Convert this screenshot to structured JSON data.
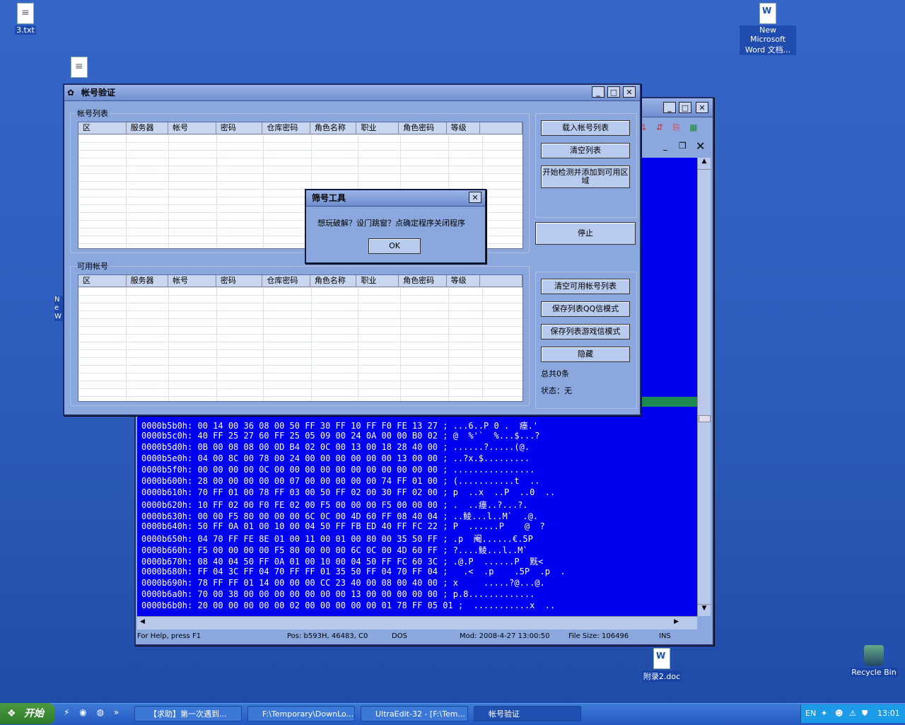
{
  "desktop": {
    "icons": [
      {
        "label": "3.txt"
      },
      {
        "label": "New Microsoft Word 文档..."
      },
      {
        "label": "附录2.doc"
      },
      {
        "label": "Recycle Bin"
      }
    ],
    "partial_label": "Ne W"
  },
  "editor": {
    "hex_lines": [
      "0000b5b0h: 00 14 00 36 08 00 50 FF 30 FF 10 FF F0 FE 13 27 ; ...6..P 0 .  瘗.'",
      "0000b5c0h: 40 FF 25 27 60 FF 25 05 09 00 24 0A 00 00 B0 02 ; @  %'`  %...$...?",
      "0000b5d0h: 0B 00 08 08 00 0D B4 02 0C 00 13 00 18 28 40 00 ; ......?.....(@.",
      "0000b5e0h: 04 00 8C 00 78 00 24 00 00 00 00 00 00 13 00 00 ; ..?x.$.........",
      "0000b5f0h: 00 00 00 00 0C 00 00 00 00 00 00 00 00 00 00 00 ; ................",
      "0000b600h: 28 00 00 00 00 00 07 00 00 00 00 00 74 FF 01 00 ; (...........t  ..",
      "0000b610h: 70 FF 01 00 78 FF 03 00 50 FF 02 00 30 FF 02 00 ; p  ..x  ..P  ..0  ..",
      "0000b620h: 10 FF 02 00 F0 FE 02 00 F5 00 00 00 F5 00 00 00 ; .  ..瘗..?...?.",
      "0000b630h: 00 00 F5 80 00 00 00 6C 0C 00 4D 60 FF 08 40 04 ; ..鲮...l..M`  .@.",
      "0000b640h: 50 FF 0A 01 00 10 00 04 50 FF FB ED 40 FF FC 22 ; P  ......P    @  ?",
      "0000b650h: 04 70 FF FE 8E 01 00 11 00 01 00 80 00 35 50 FF ; .p  阉......€.5P",
      "0000b660h: F5 00 00 00 00 F5 80 00 00 00 6C 0C 00 4D 60 FF ; ?....鲮...l..M`",
      "0000b670h: 08 40 04 50 FF 0A 01 00 10 00 04 50 FF FC 60 3C ; .@.P  ......P  黖<",
      "0000b680h: FF 04 3C FF 04 70 FF FF 01 35 50 FF 04 70 FF 04 ;   .<  .p    .5P  .p  .",
      "0000b690h: 78 FF FF 01 14 00 00 00 CC 23 40 00 08 00 40 00 ; x     .....?@...@.",
      "0000b6a0h: 70 00 38 00 00 00 00 00 00 00 13 00 00 00 00 00 ; p.8.............",
      "0000b6b0h: 20 00 00 00 00 00 02 00 00 00 00 00 01 78 FF 05 01 ;  ...........x  .."
    ],
    "status": {
      "help": "For Help, press F1",
      "pos": "Pos: b593H, 46483, C0",
      "mode": "DOS",
      "mod": "Mod: 2008-4-27 13:00:50",
      "size": "File Size: 106496",
      "ins": "INS"
    }
  },
  "main_window": {
    "title": "帐号验证",
    "account_list_label": "帐号列表",
    "available_label": "可用帐号",
    "columns": [
      "区",
      "服务器",
      "帐号",
      "密码",
      "仓库密码",
      "角色名称",
      "职业",
      "角色密码",
      "等级"
    ],
    "buttons": {
      "load": "载入帐号列表",
      "clear": "清空列表",
      "start": "开始检测并添加到可用区域",
      "stop": "停止",
      "clear_available": "清空可用帐号列表",
      "save_qq": "保存列表QQ信模式",
      "save_game": "保存列表游戏信模式",
      "hide": "隐藏"
    },
    "total": "总共0条",
    "status": "状态：无"
  },
  "dialog": {
    "title": "筛号工具",
    "message": "想玩破解？设门跳窗？点确定程序关闭程序",
    "ok": "OK"
  },
  "taskbar": {
    "start": "开始",
    "tasks": [
      "【求助】第一次遇到...",
      "F:\\Temporary\\DownLo...",
      "UltraEdit-32 - [F:\\Tem...",
      "帐号验证"
    ],
    "lang": "EN",
    "time": "13:01"
  }
}
